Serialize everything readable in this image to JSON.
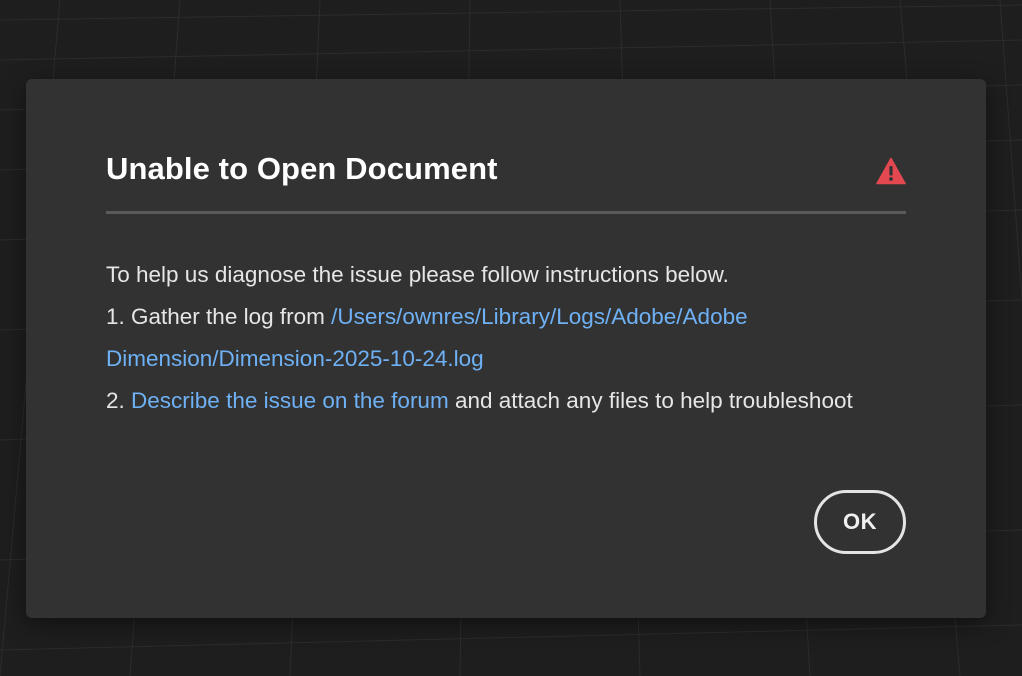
{
  "dialog": {
    "title": "Unable to Open Document",
    "alert_icon": "alert-triangle-icon",
    "intro": "To help us diagnose the issue please follow instructions below.",
    "step1_prefix": "1. Gather the log from ",
    "step1_link": "/Users/ownres/Library/Logs/Adobe/Adobe Dimension/Dimension-2025-10-24.log",
    "step2_prefix": "2. ",
    "step2_link": "Describe the issue on the forum",
    "step2_suffix": " and attach any files to help troubleshoot",
    "ok_label": "OK"
  },
  "colors": {
    "dialog_background": "#323232",
    "page_background": "#1e1e1e",
    "link": "#6eb1f5",
    "alert": "#e34850",
    "divider": "#5a5a5a"
  }
}
